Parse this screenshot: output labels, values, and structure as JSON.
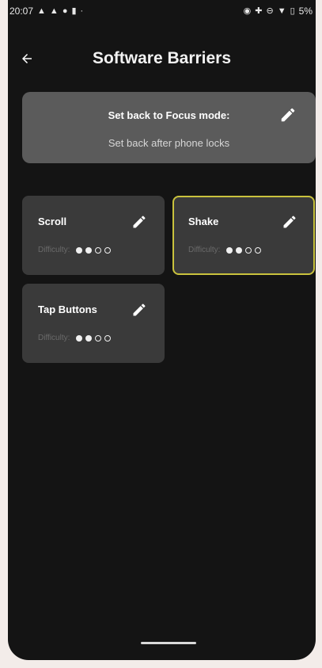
{
  "status_bar": {
    "time": "20:07",
    "battery": "5%",
    "left_icons": [
      "notification-bell-icon",
      "notification-bell-icon",
      "location-pin-icon",
      "battery-saver-icon",
      "dot-icon"
    ],
    "right_icons": [
      "alarm-icon",
      "data-saver-icon",
      "do-not-disturb-icon",
      "wifi-icon",
      "battery-icon"
    ]
  },
  "app_bar": {
    "title": "Software Barriers",
    "back_icon": "arrow-left-icon"
  },
  "focus_mode": {
    "title": "Set back to Focus mode:",
    "subtitle": "Set back after phone locks"
  },
  "barriers": [
    {
      "name": "Scroll",
      "difficulty_label": "Difficulty:",
      "difficulty": 2,
      "difficulty_max": 4,
      "selected": false
    },
    {
      "name": "Shake",
      "difficulty_label": "Difficulty:",
      "difficulty": 2,
      "difficulty_max": 4,
      "selected": true
    },
    {
      "name": "Tap Buttons",
      "difficulty_label": "Difficulty:",
      "difficulty": 2,
      "difficulty_max": 4,
      "selected": false
    }
  ],
  "colors": {
    "background": "#141414",
    "card": "#3a3a3a",
    "focus_card": "#5b5b5b",
    "selected_border": "#c9c23d"
  }
}
